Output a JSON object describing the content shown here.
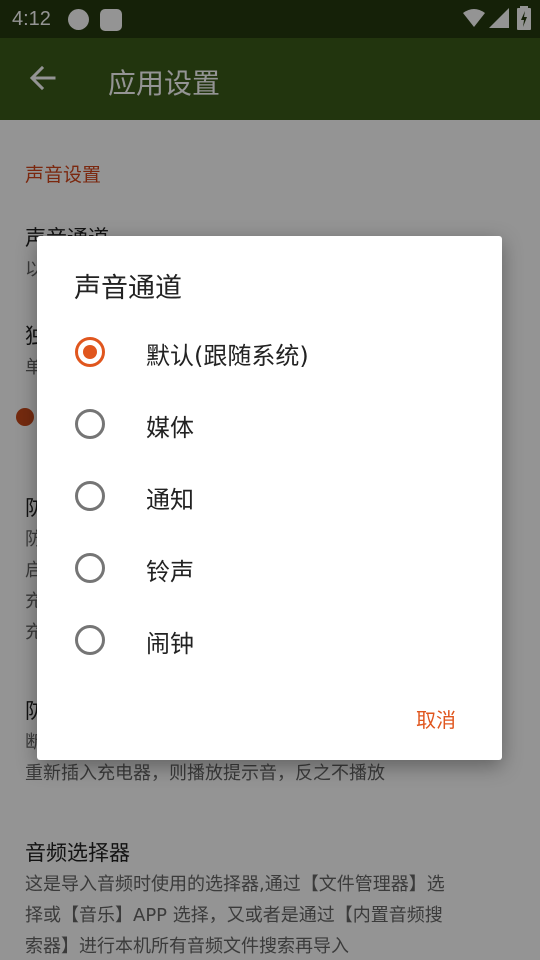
{
  "status_bar": {
    "time": "4:12"
  },
  "app_bar": {
    "title": "应用设置"
  },
  "settings": {
    "section_title": "声音设置",
    "items": [
      {
        "title": "声音通道",
        "summary": "以"
      },
      {
        "title": "独",
        "summary": "单"
      },
      {
        "title": "防",
        "summary_lines": [
          "防",
          "启",
          "充",
          "充"
        ]
      },
      {
        "title": "防",
        "summary_lines": [
          "断",
          "重新插入充电器，则播放提示音，反之不播放"
        ]
      },
      {
        "title": "音频选择器",
        "summary_lines": [
          "这是导入音频时使用的选择器,通过【文件管理器】选",
          "择或【音乐】APP 选择，又或者是通过【内置音频搜",
          "索器】进行本机所有音频文件搜索再导入"
        ]
      }
    ]
  },
  "dialog": {
    "title": "声音通道",
    "options": [
      {
        "label": "默认(跟随系统)",
        "selected": true
      },
      {
        "label": "媒体",
        "selected": false
      },
      {
        "label": "通知",
        "selected": false
      },
      {
        "label": "铃声",
        "selected": false
      },
      {
        "label": "闹钟",
        "selected": false
      }
    ],
    "cancel_label": "取消"
  },
  "colors": {
    "accent": "#e0561e",
    "app_bar": "#3c5c19",
    "status_bar": "#253a0e",
    "section_title": "#d4461a"
  }
}
